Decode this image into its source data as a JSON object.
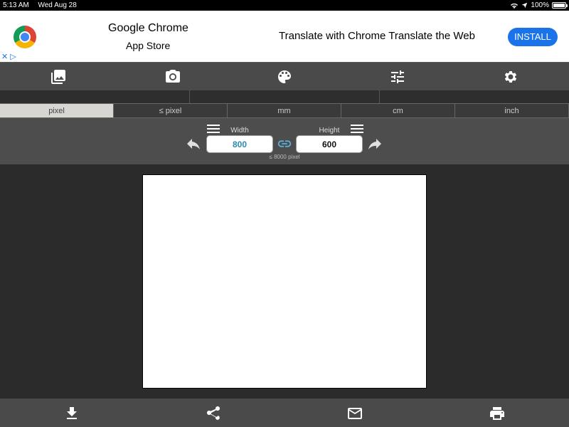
{
  "status_bar": {
    "time": "5:13 AM",
    "date": "Wed Aug 28",
    "battery": "100%"
  },
  "ad": {
    "title": "Google Chrome",
    "subtitle": "App Store",
    "text": "Translate with Chrome Translate the Web",
    "install_label": "INSTALL",
    "adchoices": "✕ ▷"
  },
  "toolbar": {
    "icons": [
      "gallery-icon",
      "camera-icon",
      "palette-icon",
      "sliders-icon",
      "gear-icon"
    ]
  },
  "units": {
    "tabs": [
      {
        "label": "pixel",
        "active": true
      },
      {
        "label": "≤ pixel",
        "active": false
      },
      {
        "label": "mm",
        "active": false
      },
      {
        "label": "cm",
        "active": false
      },
      {
        "label": "inch",
        "active": false
      }
    ]
  },
  "size": {
    "width_label": "Width",
    "height_label": "Height",
    "width_value": "800",
    "height_value": "600",
    "limit_note": "≤ 8000 pixel"
  },
  "bottom_bar": {
    "icons": [
      "download-icon",
      "share-icon",
      "mail-icon",
      "print-icon"
    ]
  }
}
